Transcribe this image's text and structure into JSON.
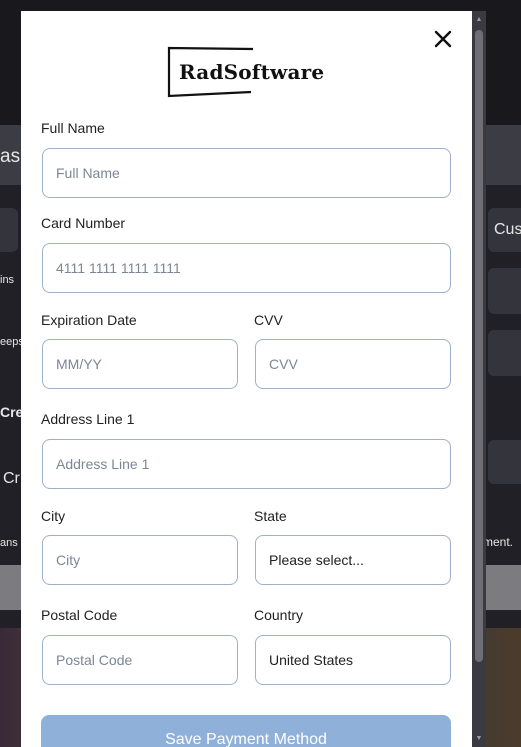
{
  "background": {
    "left_fragments": [
      "as",
      "ins",
      "eeps",
      "Cre",
      "Cr",
      "ans"
    ],
    "right_fragments": [
      "Cus",
      "ment."
    ]
  },
  "modal": {
    "logo_text": "RadSoftware",
    "close_icon": "close-icon",
    "fields": {
      "full_name": {
        "label": "Full Name",
        "placeholder": "Full Name"
      },
      "card_number": {
        "label": "Card Number",
        "placeholder": "4111 1111 1111 1111"
      },
      "expiration": {
        "label": "Expiration Date",
        "placeholder": "MM/YY"
      },
      "cvv": {
        "label": "CVV",
        "placeholder": "CVV"
      },
      "address1": {
        "label": "Address Line 1",
        "placeholder": "Address Line 1"
      },
      "city": {
        "label": "City",
        "placeholder": "City"
      },
      "state": {
        "label": "State",
        "value": "Please select..."
      },
      "postal": {
        "label": "Postal Code",
        "placeholder": "Postal Code"
      },
      "country": {
        "label": "Country",
        "value": "United States"
      }
    },
    "save_label": "Save Payment Method"
  },
  "colors": {
    "button": "#8fb0d8",
    "input_border": "#9fb0c8"
  }
}
